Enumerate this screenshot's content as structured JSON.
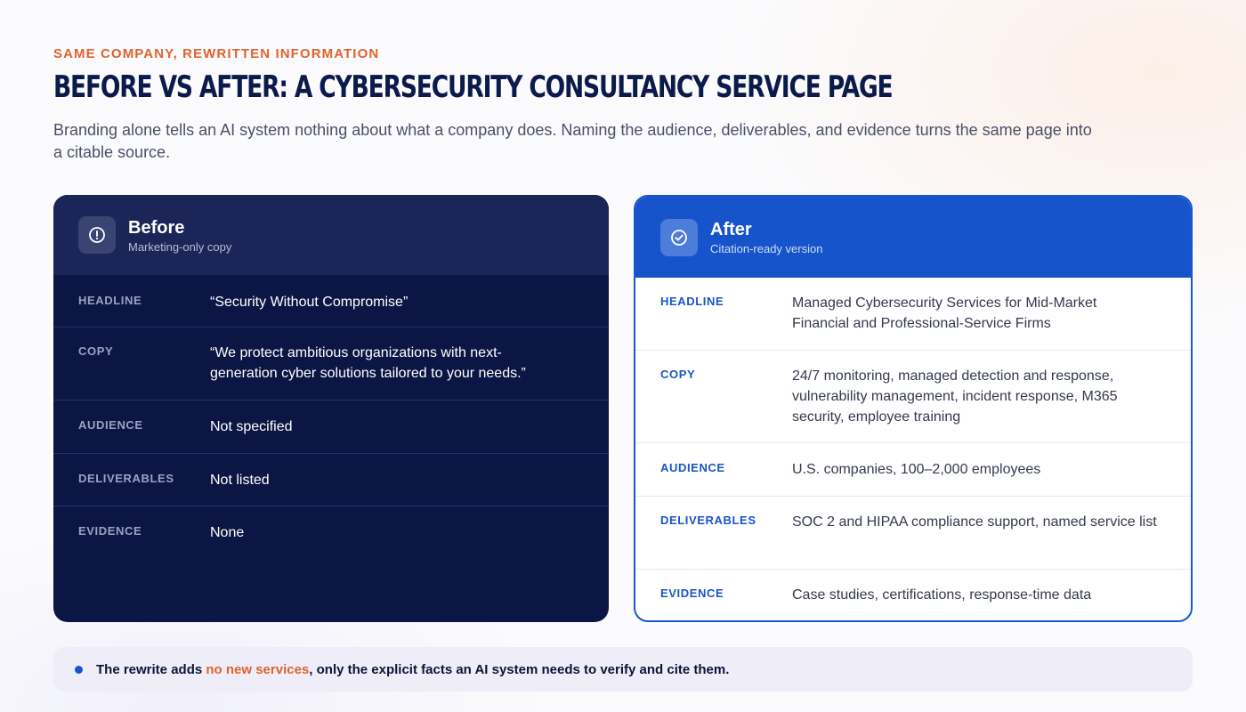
{
  "eyebrow": "SAME COMPANY, REWRITTEN INFORMATION",
  "title": "BEFORE VS AFTER: A CYBERSECURITY CONSULTANCY SERVICE PAGE",
  "subtitle": "Branding alone tells an AI system nothing about what a company does. Naming the audience, deliverables, and evidence turns the same page into a citable source.",
  "colors": {
    "accent_orange": "#e2622d",
    "navy": "#0c1645",
    "blue": "#1754cc"
  },
  "before": {
    "icon": "alert-circle-icon",
    "title": "Before",
    "subtitle": "Marketing-only copy",
    "rows": [
      {
        "label": "HEADLINE",
        "value": "“Security Without Compromise”"
      },
      {
        "label": "COPY",
        "value": "“We protect ambitious organizations with next-generation cyber solutions tailored to your needs.”"
      },
      {
        "label": "AUDIENCE",
        "value": "Not specified"
      },
      {
        "label": "DELIVERABLES",
        "value": "Not listed"
      },
      {
        "label": "EVIDENCE",
        "value": "None"
      }
    ]
  },
  "after": {
    "icon": "check-circle-icon",
    "title": "After",
    "subtitle": "Citation-ready version",
    "rows": [
      {
        "label": "HEADLINE",
        "value": "Managed Cybersecurity Services for Mid-Market Financial and Professional-Service Firms"
      },
      {
        "label": "COPY",
        "value": "24/7 monitoring, managed detection and response, vulnerability management, incident response, M365 security, employee training"
      },
      {
        "label": "AUDIENCE",
        "value": "U.S. companies, 100–2,000 employees"
      },
      {
        "label": "DELIVERABLES",
        "value": "SOC 2 and HIPAA compliance support, named service list"
      },
      {
        "label": "EVIDENCE",
        "value": "Case studies, certifications, response-time data"
      }
    ]
  },
  "footer": {
    "prefix": "The rewrite adds ",
    "highlight": "no new services",
    "suffix": ", only the explicit facts an AI system needs to verify and cite them."
  }
}
